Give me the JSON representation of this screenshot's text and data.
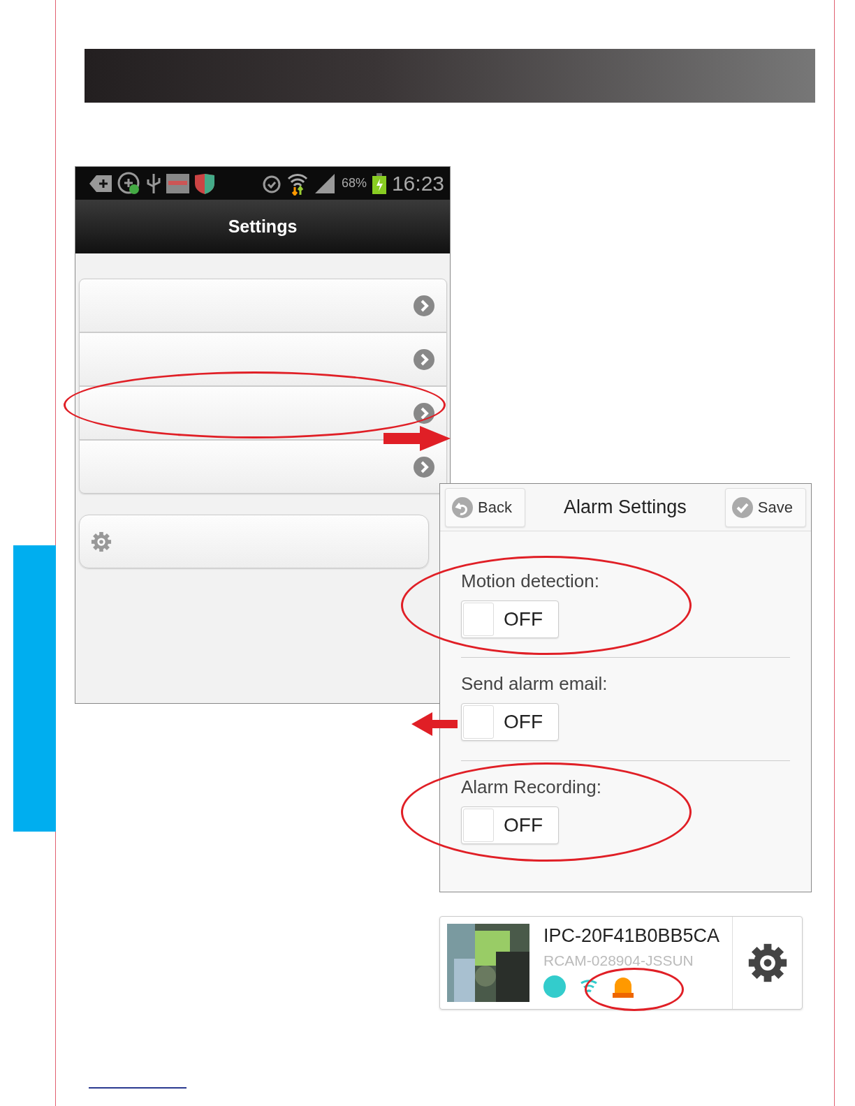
{
  "status_bar": {
    "battery": "68%",
    "time": "16:23"
  },
  "settings_screen": {
    "title": "Settings",
    "rows": [
      {
        "kind": "chevron",
        "circled": false
      },
      {
        "kind": "chevron",
        "circled": false
      },
      {
        "kind": "chevron",
        "circled": true
      },
      {
        "kind": "chevron",
        "circled": false
      },
      {
        "kind": "gear",
        "circled": false
      }
    ]
  },
  "alarm_settings": {
    "back_button": "Back",
    "title": "Alarm Settings",
    "save_button": "Save",
    "options": [
      {
        "label": "Motion detection:",
        "value": "OFF",
        "on": false,
        "circled": true
      },
      {
        "label": "Send alarm email:",
        "value": "OFF",
        "on": false,
        "circled": false
      },
      {
        "label": "Alarm Recording:",
        "value": "OFF",
        "on": false,
        "circled": true
      }
    ]
  },
  "device_card": {
    "name": "IPC-20F41B0BB5CA",
    "id": "RCAM-028904-JSSUN",
    "alarm_circled": true
  }
}
